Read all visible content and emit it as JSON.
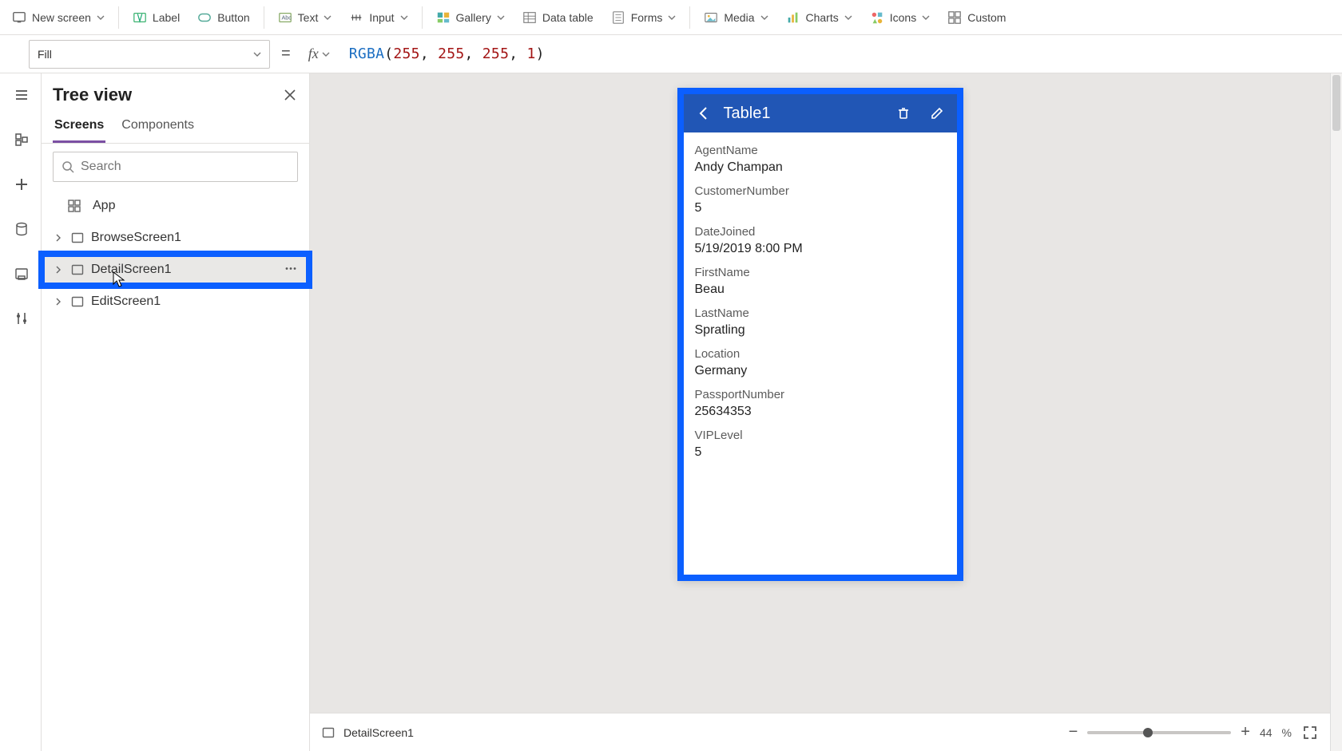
{
  "toolbar": {
    "new_screen": "New screen",
    "label": "Label",
    "button": "Button",
    "text": "Text",
    "input": "Input",
    "gallery": "Gallery",
    "data_table": "Data table",
    "forms": "Forms",
    "media": "Media",
    "charts": "Charts",
    "icons": "Icons",
    "custom": "Custom"
  },
  "property": {
    "name": "Fill",
    "fx": "fx"
  },
  "formula": {
    "fn": "RGBA",
    "args": [
      "255",
      "255",
      "255",
      "1"
    ]
  },
  "tree": {
    "title": "Tree view",
    "search_placeholder": "Search",
    "tabs": {
      "screens": "Screens",
      "components": "Components"
    },
    "app_label": "App",
    "items": [
      {
        "label": "BrowseScreen1"
      },
      {
        "label": "DetailScreen1"
      },
      {
        "label": "EditScreen1"
      }
    ]
  },
  "phone": {
    "title": "Table1",
    "fields": [
      {
        "label": "AgentName",
        "value": "Andy Champan"
      },
      {
        "label": "CustomerNumber",
        "value": "5"
      },
      {
        "label": "DateJoined",
        "value": "5/19/2019 8:00 PM"
      },
      {
        "label": "FirstName",
        "value": "Beau"
      },
      {
        "label": "LastName",
        "value": "Spratling"
      },
      {
        "label": "Location",
        "value": "Germany"
      },
      {
        "label": "PassportNumber",
        "value": "25634353"
      },
      {
        "label": "VIPLevel",
        "value": "5"
      }
    ]
  },
  "status": {
    "screen_name": "DetailScreen1",
    "zoom_value": "44",
    "zoom_unit": "%"
  }
}
